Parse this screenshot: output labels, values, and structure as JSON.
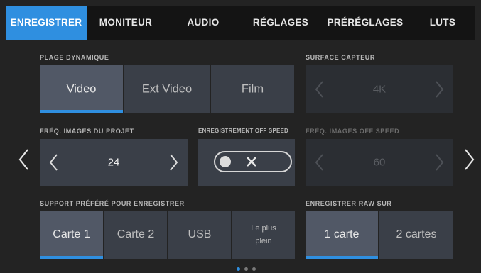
{
  "tabs": [
    {
      "label": "ENREGISTRER",
      "active": true
    },
    {
      "label": "MONITEUR",
      "active": false
    },
    {
      "label": "AUDIO",
      "active": false
    },
    {
      "label": "RÉGLAGES",
      "active": false
    },
    {
      "label": "PRÉRÉGLAGES",
      "active": false
    },
    {
      "label": "LUTS",
      "active": false
    }
  ],
  "dynamic_range": {
    "label": "PLAGE DYNAMIQUE",
    "options": [
      "Video",
      "Ext Video",
      "Film"
    ],
    "selected": "Video"
  },
  "sensor_area": {
    "label": "SURFACE CAPTEUR",
    "value": "4K",
    "enabled": false
  },
  "project_frame_rate": {
    "label": "FRÉQ. IMAGES DU PROJET",
    "value": "24"
  },
  "off_speed_recording": {
    "label": "ENREGISTREMENT OFF SPEED",
    "enabled": false
  },
  "off_speed_frame_rate": {
    "label": "FRÉQ. IMAGES OFF SPEED",
    "value": "60",
    "enabled": false
  },
  "preferred_media": {
    "label": "SUPPORT PRÉFÉRÉ POUR ENREGISTRER",
    "options": [
      "Carte 1",
      "Carte 2",
      "USB",
      "Le plus plein"
    ],
    "selected": "Carte 1"
  },
  "record_raw": {
    "label": "ENREGISTRER RAW SUR",
    "options": [
      "1 carte",
      "2 cartes"
    ],
    "selected": "1 carte"
  },
  "pagination": {
    "pages": 3,
    "current": 1
  },
  "colors": {
    "accent": "#2f8fe0",
    "background": "#232323",
    "button": "#3a3f48",
    "selected_button": "#515866"
  },
  "icons": [
    "chevron-left-icon",
    "chevron-right-icon",
    "close-icon",
    "page-prev-icon",
    "page-next-icon"
  ]
}
